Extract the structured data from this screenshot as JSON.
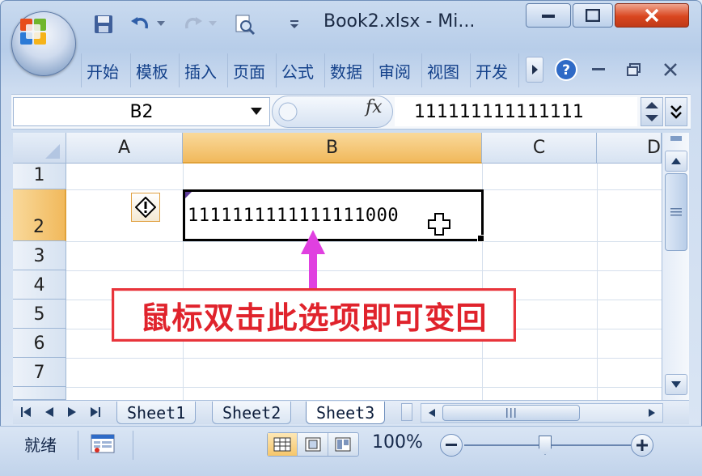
{
  "window": {
    "title": "Book2.xlsx - Mi...",
    "controls": [
      "minimize",
      "maximize",
      "close"
    ]
  },
  "quick_access": {
    "icons": [
      "save-icon",
      "undo-icon",
      "redo-icon",
      "print-preview-icon",
      "customize-icon"
    ]
  },
  "ribbon": {
    "tabs": [
      "开始",
      "模板",
      "插入",
      "页面",
      "公式",
      "数据",
      "审阅",
      "视图",
      "开发"
    ],
    "controls": [
      "tab-scroll-right",
      "help-icon",
      "minimize",
      "restore",
      "close"
    ]
  },
  "formula_bar": {
    "name_box": "B2",
    "fx": "fx",
    "value": "111111111111111"
  },
  "grid": {
    "columns": [
      "A",
      "B",
      "C",
      "D"
    ],
    "rows": [
      "1",
      "2",
      "3",
      "4",
      "5",
      "6",
      "7"
    ],
    "active_column": "B",
    "active_row": "2",
    "cell_B2": "1111111111111111000"
  },
  "annotation": {
    "text": "鼠标双击此选项即可变回",
    "arrow_color": "#e040e0",
    "box_color": "#e8343b"
  },
  "sheets": {
    "tabs": [
      "Sheet1",
      "Sheet2",
      "Sheet3"
    ],
    "active": "Sheet3"
  },
  "status_bar": {
    "status": "就绪",
    "zoom": "100%"
  }
}
